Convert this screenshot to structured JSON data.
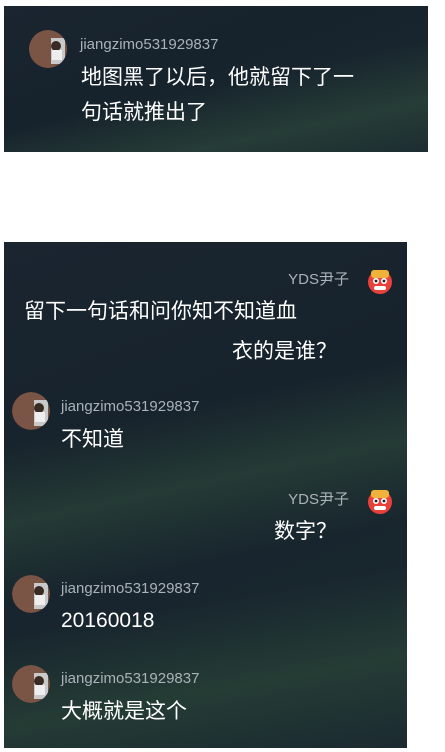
{
  "top_panel": {
    "message": {
      "username": "jiangzimo531929837",
      "line1": "地图黑了以后，他就留下了一",
      "line2": "句话就推出了"
    }
  },
  "bottom_panel": {
    "messages": [
      {
        "side": "right",
        "username": "YDS尹子",
        "line1": "留下一句话和问你知不知道血",
        "line2": "衣的是谁？"
      },
      {
        "side": "left",
        "username": "jiangzimo531929837",
        "text": "不知道"
      },
      {
        "side": "right",
        "username": "YDS尹子",
        "text": "数字？"
      },
      {
        "side": "left",
        "username": "jiangzimo531929837",
        "text": "20160018"
      },
      {
        "side": "left",
        "username": "jiangzimo531929837",
        "text": "大概就是这个"
      }
    ]
  },
  "icons": {
    "left_user_avatar": "user-avatar-icon",
    "right_user_avatar": "red-lion-mascot-icon"
  },
  "colors": {
    "panel_bg": "#17232d",
    "username": "#aab2b8",
    "message_text": "#ffffff",
    "mascot_red": "#e8413c"
  }
}
